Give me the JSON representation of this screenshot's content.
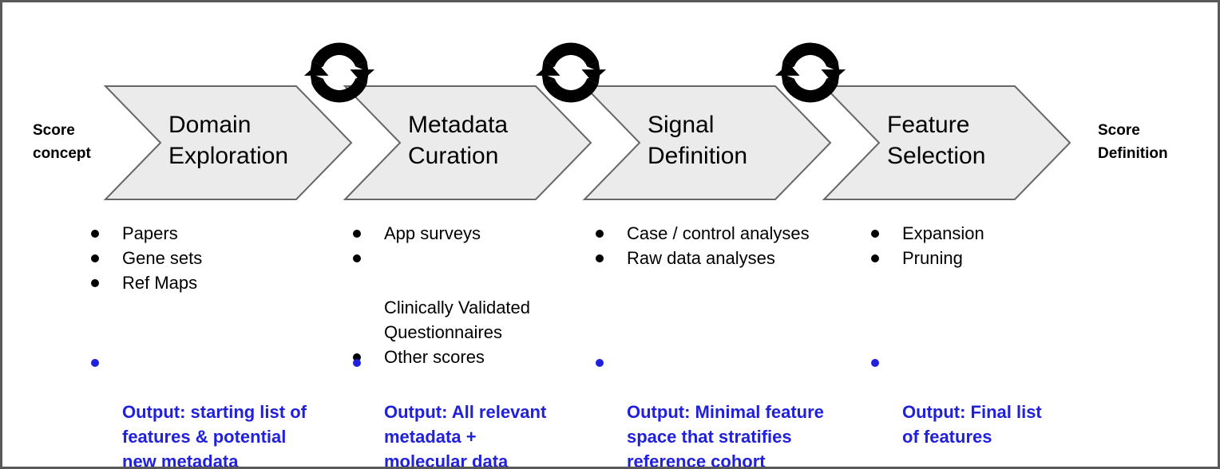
{
  "diagram": {
    "start_label": "Score\nconcept",
    "end_label": "Score\nDefinition",
    "stages": [
      {
        "title": "Domain\nExploration",
        "bullets": [
          "Papers",
          "Gene sets",
          "Ref Maps"
        ],
        "output": "Output: starting list of\nfeatures & potential\nnew metadata"
      },
      {
        "title": "Metadata\nCuration",
        "bullets": [
          "App surveys",
          "Clinically Validated\nQuestionnaires",
          "Other scores"
        ],
        "output": "Output: All relevant\nmetadata +\nmolecular data"
      },
      {
        "title": "Signal\nDefinition",
        "bullets": [
          "Case / control analyses",
          "Raw data analyses"
        ],
        "output": "Output: Minimal feature\nspace that stratifies\nreference cohort"
      },
      {
        "title": "Feature\nSelection",
        "bullets": [
          "Expansion",
          "Pruning"
        ],
        "output": "Output: Final list\nof features"
      }
    ],
    "cycle_icons": [
      "cycle-arrows-icon",
      "cycle-arrows-icon",
      "cycle-arrows-icon"
    ],
    "colors": {
      "chevron_fill": "#ebebeb",
      "chevron_stroke": "#676767",
      "output_text": "#2020dd",
      "border": "#595959",
      "icon": "#000000",
      "text": "#000000"
    }
  }
}
